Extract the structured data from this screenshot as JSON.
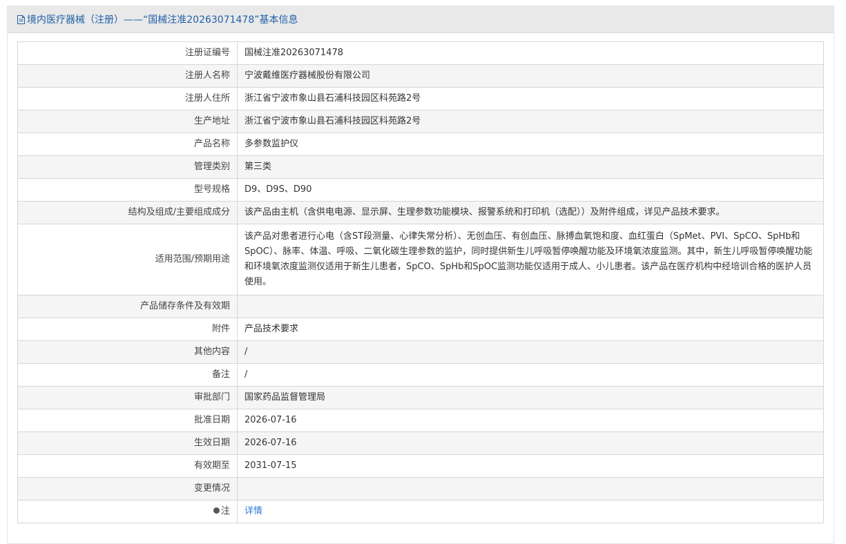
{
  "header": {
    "title": "境内医疗器械（注册）——“国械注准20263071478”基本信息",
    "icon": "document-icon"
  },
  "rows": [
    {
      "label": "注册证编号",
      "value": "国械注准20263071478"
    },
    {
      "label": "注册人名称",
      "value": "宁波戴维医疗器械股份有限公司"
    },
    {
      "label": "注册人住所",
      "value": "浙江省宁波市象山县石浦科技园区科苑路2号"
    },
    {
      "label": "生产地址",
      "value": "浙江省宁波市象山县石浦科技园区科苑路2号"
    },
    {
      "label": "产品名称",
      "value": "多参数监护仪"
    },
    {
      "label": "管理类别",
      "value": "第三类"
    },
    {
      "label": "型号规格",
      "value": "D9、D9S、D90"
    },
    {
      "label": "结构及组成/主要组成成分",
      "value": "该产品由主机（含供电电源、显示屏、生理参数功能模块、报警系统和打印机（选配））及附件组成，详见产品技术要求。"
    },
    {
      "label": "适用范围/预期用途",
      "value": "该产品对患者进行心电（含ST段测量、心律失常分析）、无创血压、有创血压、脉搏血氧饱和度、血红蛋白（SpMet、PVI、SpCO、SpHb和SpOC）、脉率、体温、呼吸、二氧化碳生理参数的监护，同时提供新生儿呼吸暂停唤醒功能及环境氧浓度监测。其中，新生儿呼吸暂停唤醒功能和环境氧浓度监测仅适用于新生儿患者，SpCO、SpHb和SpOC监测功能仅适用于成人、小儿患者。该产品在医疗机构中经培训合格的医护人员使用。"
    },
    {
      "label": "产品储存条件及有效期",
      "value": ""
    },
    {
      "label": "附件",
      "value": "产品技术要求"
    },
    {
      "label": "其他内容",
      "value": "/"
    },
    {
      "label": "备注",
      "value": "/"
    },
    {
      "label": "审批部门",
      "value": "国家药品监督管理局"
    },
    {
      "label": "批准日期",
      "value": "2026-07-16"
    },
    {
      "label": "生效日期",
      "value": "2026-07-16"
    },
    {
      "label": "有效期至",
      "value": "2031-07-15"
    },
    {
      "label": "变更情况",
      "value": ""
    }
  ],
  "note_row": {
    "label": "注",
    "icon": "info-bullet-icon",
    "link": "详情"
  },
  "colors": {
    "header_text": "#1f5fa8",
    "link": "#2a7ad2",
    "row_alt": "#f5f5f5"
  }
}
